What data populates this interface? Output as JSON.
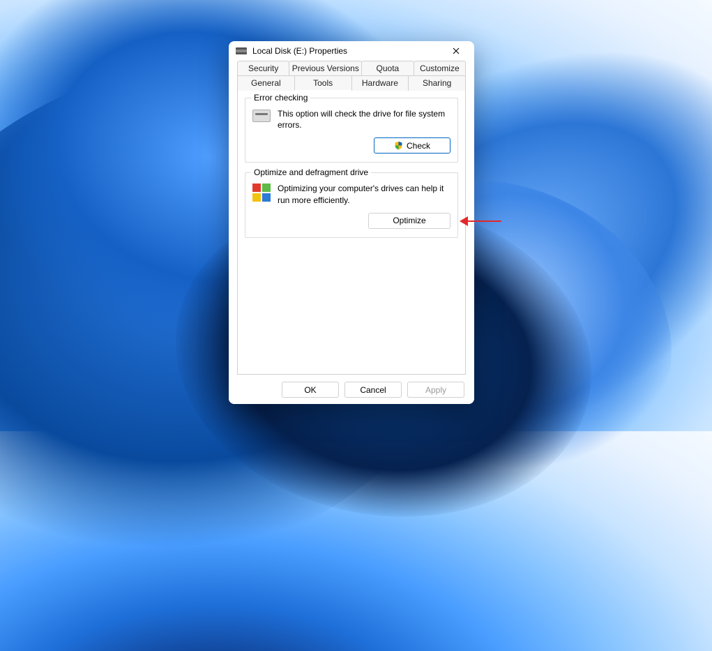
{
  "dialog": {
    "title": "Local Disk (E:) Properties",
    "tabs_row1": [
      {
        "label": "Security"
      },
      {
        "label": "Previous Versions"
      },
      {
        "label": "Quota"
      },
      {
        "label": "Customize"
      }
    ],
    "tabs_row2": [
      {
        "label": "General"
      },
      {
        "label": "Tools",
        "active": true
      },
      {
        "label": "Hardware"
      },
      {
        "label": "Sharing"
      }
    ],
    "group_error": {
      "legend": "Error checking",
      "text": "This option will check the drive for file system errors.",
      "button": "Check"
    },
    "group_optimize": {
      "legend": "Optimize and defragment drive",
      "text": "Optimizing your computer's drives can help it run more efficiently.",
      "button": "Optimize"
    },
    "footer": {
      "ok": "OK",
      "cancel": "Cancel",
      "apply": "Apply"
    }
  }
}
